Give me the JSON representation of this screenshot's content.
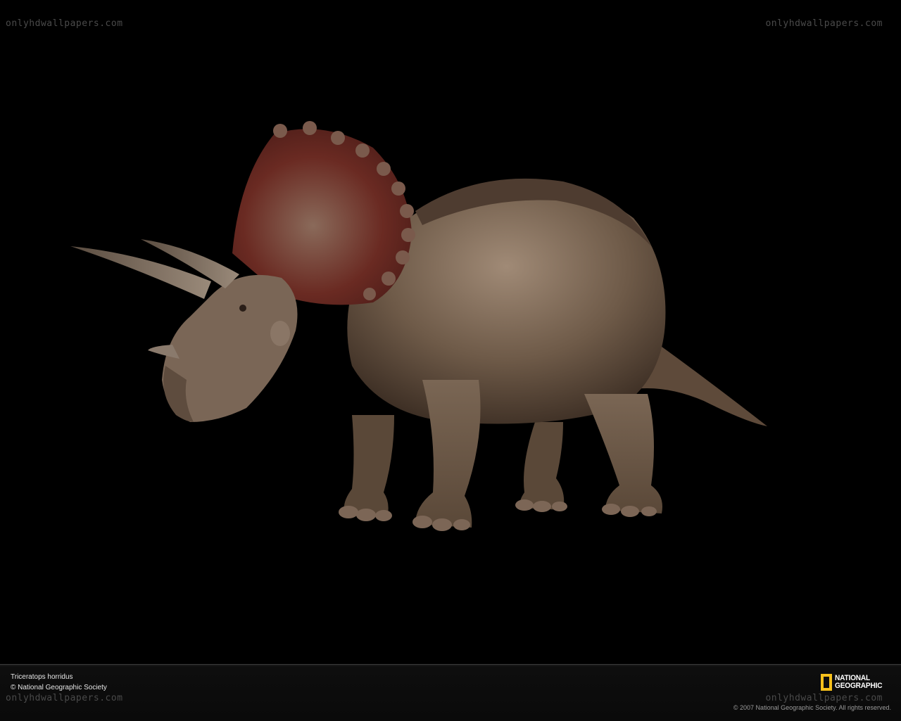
{
  "watermarks": {
    "top_left": "onlyhdwallpapers.com",
    "top_right": "onlyhdwallpapers.com",
    "bottom_left": "onlyhdwallpapers.com",
    "bottom_right": "onlyhdwallpapers.com"
  },
  "subject": {
    "colors": {
      "body": "#6e5a48",
      "body_light": "#9a8470",
      "shadow": "#3a2c22",
      "frill": "#6a2a22",
      "horn": "#8a7a6c"
    }
  },
  "footer": {
    "caption_species": "Triceratops horridus",
    "caption_credit": "© National Geographic Society",
    "logo_text_line1": "NATIONAL",
    "logo_text_line2": "GEOGRAPHIC",
    "copyright": "© 2007 National Geographic Society. All rights reserved.",
    "logo_color": "#f6c11b",
    "bar_color": "#0e0e0e"
  }
}
